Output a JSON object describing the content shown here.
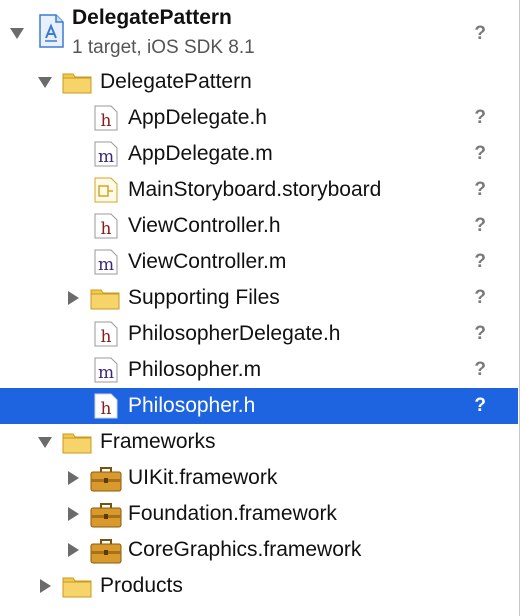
{
  "project": {
    "title": "DelegatePattern",
    "subtitle": "1 target, iOS SDK 8.1",
    "status": "?"
  },
  "groups": {
    "main": {
      "label": "DelegatePattern"
    },
    "frameworks": {
      "label": "Frameworks"
    },
    "products": {
      "label": "Products"
    }
  },
  "files": [
    {
      "label": "AppDelegate.h",
      "type": "h",
      "status": "?"
    },
    {
      "label": "AppDelegate.m",
      "type": "m",
      "status": "?"
    },
    {
      "label": "MainStoryboard.storyboard",
      "type": "storyboard",
      "status": "?"
    },
    {
      "label": "ViewController.h",
      "type": "h",
      "status": "?"
    },
    {
      "label": "ViewController.m",
      "type": "m",
      "status": "?"
    },
    {
      "label": "Supporting Files",
      "type": "folder",
      "status": "?"
    },
    {
      "label": "PhilosopherDelegate.h",
      "type": "h",
      "status": "?"
    },
    {
      "label": "Philosopher.m",
      "type": "m",
      "status": "?"
    },
    {
      "label": "Philosopher.h",
      "type": "h",
      "status": "?",
      "selected": true
    }
  ],
  "frameworks": [
    {
      "label": "UIKit.framework"
    },
    {
      "label": "Foundation.framework"
    },
    {
      "label": "CoreGraphics.framework"
    }
  ],
  "colors": {
    "selection": "#1e63e0",
    "folder": "#f2c94c",
    "h_letter": "#8b1a1a",
    "m_letter": "#3b2a7a",
    "framework": "#d89a2b"
  }
}
